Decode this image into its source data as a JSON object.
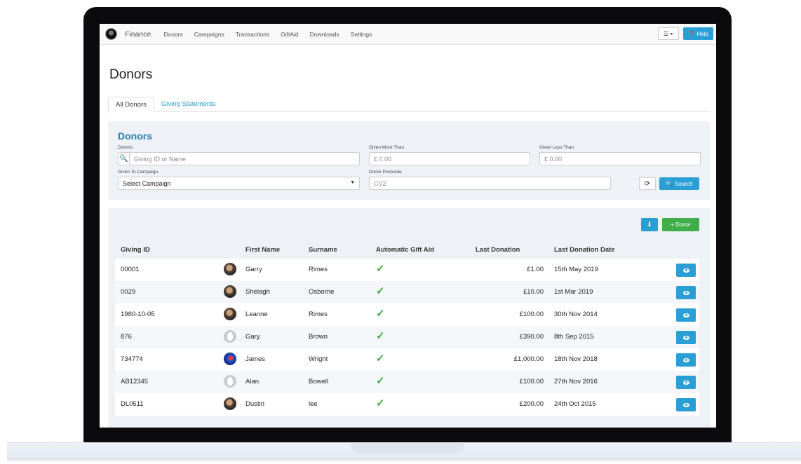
{
  "navbar": {
    "brand": "Finance",
    "items": [
      "Donors",
      "Campaigns",
      "Transactions",
      "GiftAid",
      "Downloads",
      "Settings"
    ],
    "help_label": "Help",
    "list_icon": "list-icon"
  },
  "page": {
    "title": "Donors"
  },
  "tabs": [
    {
      "label": "All Donors",
      "active": true
    },
    {
      "label": "Giving Statements",
      "active": false
    }
  ],
  "filter": {
    "title": "Donors",
    "donors_label": "Donors",
    "donors_placeholder": "Giving ID or Name",
    "given_more_label": "Given More Than",
    "given_more_value": "£ 0.00",
    "given_less_label": "Given Less Than",
    "given_less_value": "£ 0.00",
    "campaign_label": "Given To Campaign",
    "campaign_value": "Select Campaign",
    "postcode_label": "Donor Postcode",
    "postcode_value": "CV2",
    "search_label": "Search"
  },
  "actions": {
    "add_donor_label": "Donor"
  },
  "table": {
    "headers": [
      "Giving ID",
      "First Name",
      "Surname",
      "Automatic Gift Aid",
      "Last Donation",
      "Last Donation Date"
    ],
    "rows": [
      {
        "id": "00001",
        "first": "Garry",
        "surname": "Rimes",
        "gift_aid": true,
        "last": "£1.00",
        "date": "15th May 2019",
        "avatar": "photo"
      },
      {
        "id": "0029",
        "first": "Shelagh",
        "surname": "Osborne",
        "gift_aid": true,
        "last": "£10.00",
        "date": "1st Mar 2019",
        "avatar": "photo"
      },
      {
        "id": "1980-10-05",
        "first": "Leanne",
        "surname": "Rimes",
        "gift_aid": true,
        "last": "£100.00",
        "date": "30th Nov 2014",
        "avatar": "photo"
      },
      {
        "id": "876",
        "first": "Gary",
        "surname": "Brown",
        "gift_aid": true,
        "last": "£390.00",
        "date": "8th Sep 2015",
        "avatar": "blank"
      },
      {
        "id": "734774",
        "first": "James",
        "surname": "Wright",
        "gift_aid": true,
        "last": "£1,000.00",
        "date": "18th Nov 2018",
        "avatar": "blue"
      },
      {
        "id": "AB12345",
        "first": "Alan",
        "surname": "Bowell",
        "gift_aid": true,
        "last": "£100.00",
        "date": "27th Nov 2016",
        "avatar": "blank"
      },
      {
        "id": "DL0511",
        "first": "Dustin",
        "surname": "lee",
        "gift_aid": true,
        "last": "£200.00",
        "date": "24th Oct 2015",
        "avatar": "photo"
      }
    ]
  },
  "colors": {
    "primary": "#2a9fd6",
    "success": "#3fae49",
    "panel": "#eef2f7"
  }
}
